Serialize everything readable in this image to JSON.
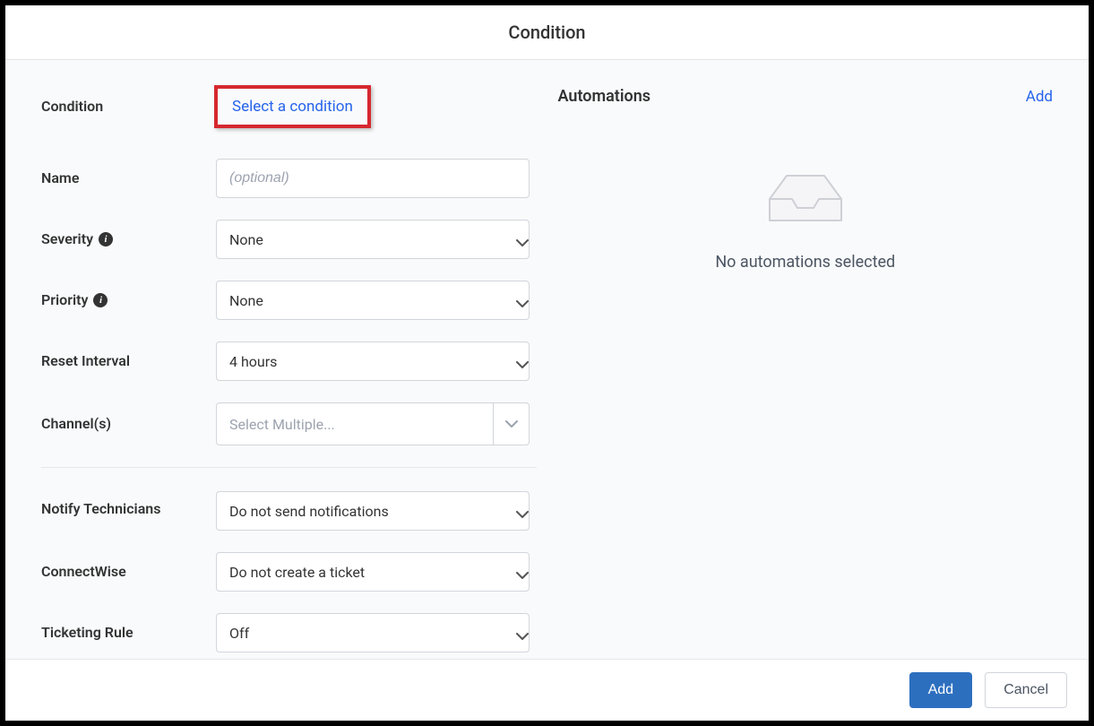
{
  "header": {
    "title": "Condition"
  },
  "form": {
    "condition": {
      "label": "Condition",
      "link_text": "Select a condition"
    },
    "name": {
      "label": "Name",
      "placeholder": "(optional)",
      "value": ""
    },
    "severity": {
      "label": "Severity",
      "value": "None"
    },
    "priority": {
      "label": "Priority",
      "value": "None"
    },
    "reset_interval": {
      "label": "Reset Interval",
      "value": "4 hours"
    },
    "channels": {
      "label": "Channel(s)",
      "placeholder": "Select Multiple..."
    },
    "notify_technicians": {
      "label": "Notify Technicians",
      "value": "Do not send notifications"
    },
    "connectwise": {
      "label": "ConnectWise",
      "value": "Do not create a ticket"
    },
    "ticketing_rule": {
      "label": "Ticketing Rule",
      "value": "Off"
    }
  },
  "automations": {
    "title": "Automations",
    "add_label": "Add",
    "empty_text": "No automations selected"
  },
  "footer": {
    "add": "Add",
    "cancel": "Cancel"
  },
  "icons": {
    "info": "i"
  }
}
